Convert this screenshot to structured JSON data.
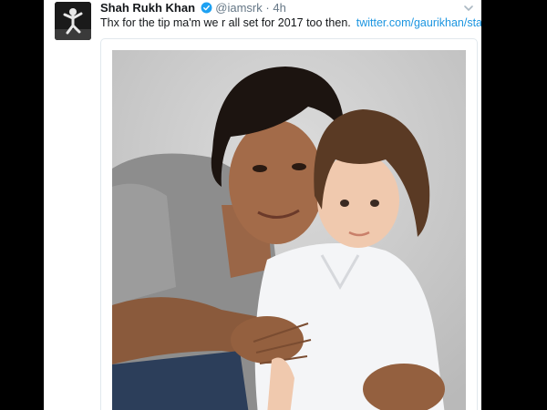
{
  "tweet": {
    "display_name": "Shah Rukh Khan",
    "handle": "@iamsrk",
    "separator": "·",
    "time": "4h",
    "text": "Thx for the tip ma'm we r all set for 2017 too then.",
    "link": "twitter.com/gaurikhan/stat...",
    "avatar_icon": "profile-photo-icon",
    "verified_icon": "verified-badge-icon",
    "menu_icon": "chevron-down-icon",
    "accent_color": "#1b95e0"
  }
}
